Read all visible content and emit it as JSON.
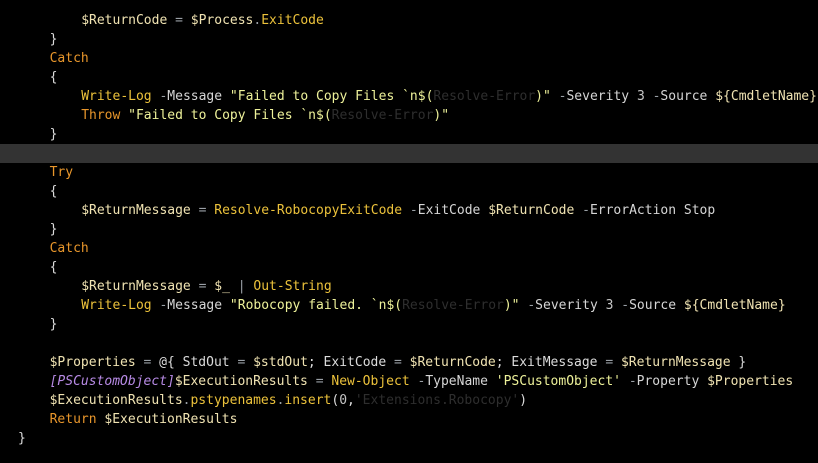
{
  "colors": {
    "background": "#000000",
    "current_line": "#333333",
    "variable": "#f0e3b2",
    "operator": "#9aa0a6",
    "keyword": "#e8962b",
    "command": "#ecc23b",
    "parameter": "#d6d6d6",
    "string": "#eef29a",
    "number": "#c6c6c6",
    "type": "#b88be6",
    "faded": "#2e2e2e"
  },
  "editor": {
    "lines": [
      {
        "indent": 8,
        "tokens": [
          {
            "t": "var",
            "v": "$ReturnCode"
          },
          {
            "t": "op",
            "v": " = "
          },
          {
            "t": "var",
            "v": "$Process"
          },
          {
            "t": "op",
            "v": "."
          },
          {
            "t": "cmd",
            "v": "ExitCode"
          }
        ]
      },
      {
        "indent": 4,
        "tokens": [
          {
            "t": "plain",
            "v": "}"
          }
        ]
      },
      {
        "indent": 4,
        "tokens": [
          {
            "t": "kw",
            "v": "Catch"
          }
        ]
      },
      {
        "indent": 4,
        "tokens": [
          {
            "t": "plain",
            "v": "{"
          }
        ]
      },
      {
        "indent": 8,
        "tokens": [
          {
            "t": "cmd",
            "v": "Write-Log"
          },
          {
            "t": "plain",
            "v": " "
          },
          {
            "t": "op",
            "v": "-"
          },
          {
            "t": "param",
            "v": "Message"
          },
          {
            "t": "plain",
            "v": " "
          },
          {
            "t": "str",
            "v": "\"Failed to Copy Files `n$("
          },
          {
            "t": "fade",
            "v": "Resolve-Error"
          },
          {
            "t": "str",
            "v": ")\""
          },
          {
            "t": "plain",
            "v": " "
          },
          {
            "t": "op",
            "v": "-"
          },
          {
            "t": "param",
            "v": "Severity"
          },
          {
            "t": "plain",
            "v": " "
          },
          {
            "t": "num",
            "v": "3"
          },
          {
            "t": "plain",
            "v": " "
          },
          {
            "t": "op",
            "v": "-"
          },
          {
            "t": "param",
            "v": "Source"
          },
          {
            "t": "plain",
            "v": " "
          },
          {
            "t": "var",
            "v": "${CmdletName}"
          }
        ]
      },
      {
        "indent": 8,
        "tokens": [
          {
            "t": "kw",
            "v": "Throw"
          },
          {
            "t": "plain",
            "v": " "
          },
          {
            "t": "str",
            "v": "\"Failed to Copy Files `n$("
          },
          {
            "t": "fade",
            "v": "Resolve-Error"
          },
          {
            "t": "str",
            "v": ")\""
          }
        ]
      },
      {
        "indent": 4,
        "tokens": [
          {
            "t": "plain",
            "v": "}"
          }
        ]
      },
      {
        "indent": 0,
        "highlight": true,
        "tokens": []
      },
      {
        "indent": 4,
        "tokens": [
          {
            "t": "kw",
            "v": "Try"
          }
        ]
      },
      {
        "indent": 4,
        "tokens": [
          {
            "t": "plain",
            "v": "{"
          }
        ]
      },
      {
        "indent": 8,
        "tokens": [
          {
            "t": "var",
            "v": "$ReturnMessage"
          },
          {
            "t": "op",
            "v": " = "
          },
          {
            "t": "cmd",
            "v": "Resolve-RobocopyExitCode"
          },
          {
            "t": "plain",
            "v": " "
          },
          {
            "t": "op",
            "v": "-"
          },
          {
            "t": "param",
            "v": "ExitCode"
          },
          {
            "t": "plain",
            "v": " "
          },
          {
            "t": "var",
            "v": "$ReturnCode"
          },
          {
            "t": "plain",
            "v": " "
          },
          {
            "t": "op",
            "v": "-"
          },
          {
            "t": "param",
            "v": "ErrorAction"
          },
          {
            "t": "plain",
            "v": " "
          },
          {
            "t": "param",
            "v": "Stop"
          }
        ]
      },
      {
        "indent": 4,
        "tokens": [
          {
            "t": "plain",
            "v": "}"
          }
        ]
      },
      {
        "indent": 4,
        "tokens": [
          {
            "t": "kw",
            "v": "Catch"
          }
        ]
      },
      {
        "indent": 4,
        "tokens": [
          {
            "t": "plain",
            "v": "{"
          }
        ]
      },
      {
        "indent": 8,
        "tokens": [
          {
            "t": "var",
            "v": "$ReturnMessage"
          },
          {
            "t": "op",
            "v": " = "
          },
          {
            "t": "var",
            "v": "$_"
          },
          {
            "t": "op",
            "v": " | "
          },
          {
            "t": "cmd",
            "v": "Out-String"
          }
        ]
      },
      {
        "indent": 8,
        "tokens": [
          {
            "t": "cmd",
            "v": "Write-Log"
          },
          {
            "t": "plain",
            "v": " "
          },
          {
            "t": "op",
            "v": "-"
          },
          {
            "t": "param",
            "v": "Message"
          },
          {
            "t": "plain",
            "v": " "
          },
          {
            "t": "str",
            "v": "\"Robocopy failed. `n$("
          },
          {
            "t": "fade",
            "v": "Resolve-Error"
          },
          {
            "t": "str",
            "v": ")\""
          },
          {
            "t": "plain",
            "v": " "
          },
          {
            "t": "op",
            "v": "-"
          },
          {
            "t": "param",
            "v": "Severity"
          },
          {
            "t": "plain",
            "v": " "
          },
          {
            "t": "num",
            "v": "3"
          },
          {
            "t": "plain",
            "v": " "
          },
          {
            "t": "op",
            "v": "-"
          },
          {
            "t": "param",
            "v": "Source"
          },
          {
            "t": "plain",
            "v": " "
          },
          {
            "t": "var",
            "v": "${CmdletName}"
          }
        ]
      },
      {
        "indent": 4,
        "tokens": [
          {
            "t": "plain",
            "v": "}"
          }
        ]
      },
      {
        "indent": 0,
        "tokens": []
      },
      {
        "indent": 4,
        "tokens": [
          {
            "t": "var",
            "v": "$Properties"
          },
          {
            "t": "op",
            "v": " = "
          },
          {
            "t": "plain",
            "v": "@{ StdOut "
          },
          {
            "t": "op",
            "v": "="
          },
          {
            "t": "plain",
            "v": " "
          },
          {
            "t": "var",
            "v": "$stdOut"
          },
          {
            "t": "plain",
            "v": "; ExitCode "
          },
          {
            "t": "op",
            "v": "="
          },
          {
            "t": "plain",
            "v": " "
          },
          {
            "t": "var",
            "v": "$ReturnCode"
          },
          {
            "t": "plain",
            "v": "; ExitMessage "
          },
          {
            "t": "op",
            "v": "="
          },
          {
            "t": "plain",
            "v": " "
          },
          {
            "t": "var",
            "v": "$ReturnMessage"
          },
          {
            "t": "plain",
            "v": " }"
          }
        ]
      },
      {
        "indent": 4,
        "tokens": [
          {
            "t": "type",
            "v": "[PSCustomObject]"
          },
          {
            "t": "var",
            "v": "$ExecutionResults"
          },
          {
            "t": "op",
            "v": " = "
          },
          {
            "t": "cmd",
            "v": "New-Object"
          },
          {
            "t": "plain",
            "v": " "
          },
          {
            "t": "op",
            "v": "-"
          },
          {
            "t": "param",
            "v": "TypeName"
          },
          {
            "t": "plain",
            "v": " "
          },
          {
            "t": "str",
            "v": "'PSCustomObject'"
          },
          {
            "t": "plain",
            "v": " "
          },
          {
            "t": "op",
            "v": "-"
          },
          {
            "t": "param",
            "v": "Property"
          },
          {
            "t": "plain",
            "v": " "
          },
          {
            "t": "var",
            "v": "$Properties"
          }
        ]
      },
      {
        "indent": 4,
        "tokens": [
          {
            "t": "var",
            "v": "$ExecutionResults"
          },
          {
            "t": "op",
            "v": "."
          },
          {
            "t": "cmd",
            "v": "pstypenames"
          },
          {
            "t": "op",
            "v": "."
          },
          {
            "t": "cmd",
            "v": "insert"
          },
          {
            "t": "plain",
            "v": "("
          },
          {
            "t": "num",
            "v": "0"
          },
          {
            "t": "plain",
            "v": ","
          },
          {
            "t": "fade",
            "v": "'Extensions.Robocopy'"
          },
          {
            "t": "plain",
            "v": ")"
          }
        ]
      },
      {
        "indent": 4,
        "tokens": [
          {
            "t": "kw",
            "v": "Return"
          },
          {
            "t": "plain",
            "v": " "
          },
          {
            "t": "var",
            "v": "$ExecutionResults"
          }
        ]
      },
      {
        "indent": 0,
        "tokens": [
          {
            "t": "plain",
            "v": "}"
          }
        ]
      }
    ]
  }
}
